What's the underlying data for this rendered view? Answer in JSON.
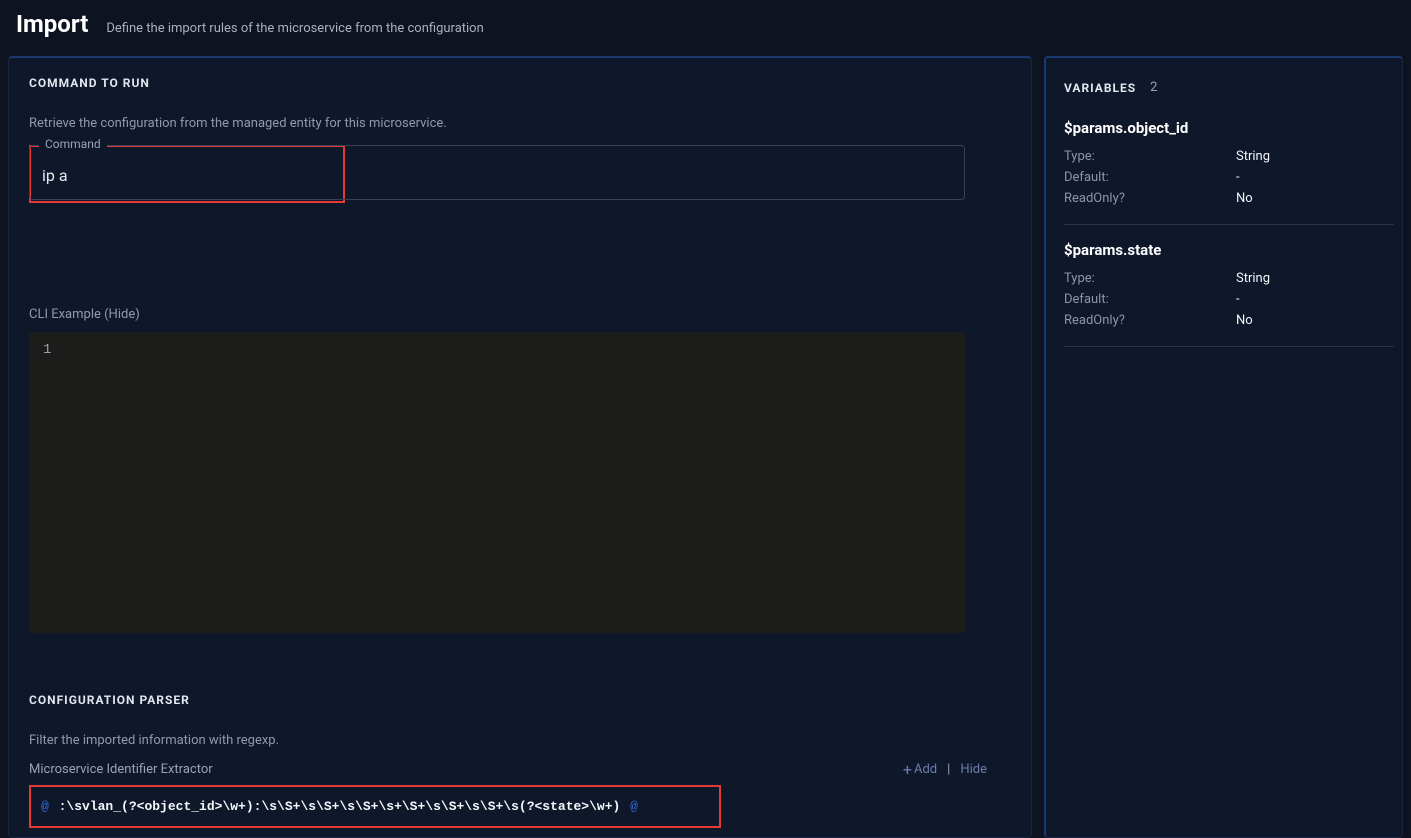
{
  "header": {
    "title": "Import",
    "subtitle": "Define the import rules of the microservice from the configuration"
  },
  "main": {
    "command_section": {
      "title": "COMMAND TO RUN",
      "description": "Retrieve the configuration from the managed entity for this microservice.",
      "command_label": "Command",
      "command_value": "ip a",
      "cli_label": "CLI Example (Hide)",
      "cli_content": "1"
    },
    "parser_section": {
      "title": "CONFIGURATION PARSER",
      "description": "Filter the imported information with regexp.",
      "extractor_label": "Microservice Identifier Extractor",
      "add_label": "Add",
      "divider": "|",
      "hide_label": "Hide",
      "delimiter": "@",
      "pattern": ":\\svlan_(?<object_id>\\w+):\\s\\S+\\s\\S+\\s\\S+\\s+\\S+\\s\\S+\\s\\S+\\s(?<state>\\w+)"
    }
  },
  "sidebar": {
    "title": "VARIABLES",
    "count": "2",
    "vars": [
      {
        "name": "$params.object_id",
        "type_k": "Type:",
        "type_v": "String",
        "def_k": "Default:",
        "def_v": "-",
        "ro_k": "ReadOnly?",
        "ro_v": "No"
      },
      {
        "name": "$params.state",
        "type_k": "Type:",
        "type_v": "String",
        "def_k": "Default:",
        "def_v": "-",
        "ro_k": "ReadOnly?",
        "ro_v": "No"
      }
    ]
  }
}
